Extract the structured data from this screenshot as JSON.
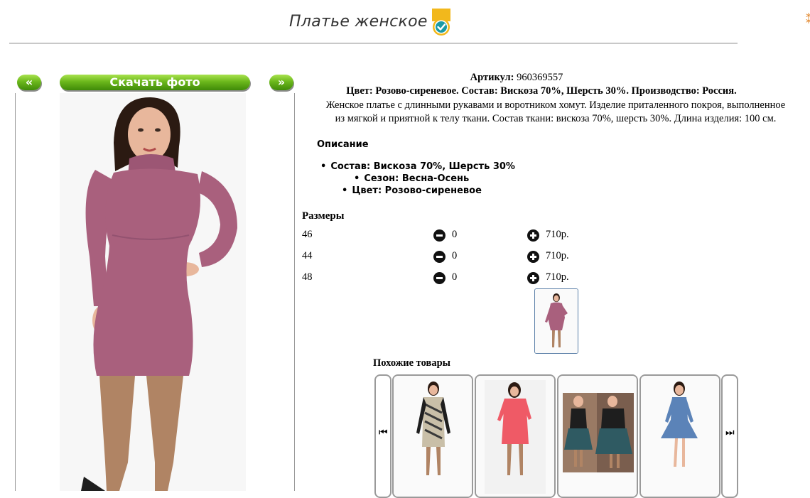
{
  "product": {
    "title": "Платье женское",
    "article_label": "Артикул:",
    "article_value": "960369557",
    "spec_line": "Цвет: Розово-сиреневое. Состав: Вискоза 70%, Шерсть 30%. Производство: Россия.",
    "description_line1": "Женское платье с длинными рукавами и воротником хомут. Изделие приталенного покроя, выполненное",
    "description_line2": "из мягкой и приятной к телу ткани. Состав ткани: вискоза 70%, шерсть 30%. Длина изделия: 100 см.",
    "verified_icon": "check-badge-icon"
  },
  "photo_nav": {
    "prev_label": "«",
    "download_label": "Скачать фото",
    "next_label": "»"
  },
  "description_block": {
    "title": "Описание",
    "items": [
      "Состав: Вискоза 70%, Шерсть 30%",
      "Сезон: Весна-Осень",
      "Цвет: Розово-сиреневое"
    ]
  },
  "sizes": {
    "title": "Размеры",
    "rows": [
      {
        "size": "46",
        "qty": "0",
        "price": "710р."
      },
      {
        "size": "44",
        "qty": "0",
        "price": "710р."
      },
      {
        "size": "48",
        "qty": "0",
        "price": "710р."
      }
    ]
  },
  "similar": {
    "title": "Похожие товары",
    "prev_icon": "skip-prev-icon",
    "next_icon": "skip-next-icon"
  },
  "colors": {
    "accent_green": "#6cb81c",
    "dress_mauve": "#a9607d",
    "badge_gold": "#f2b81c",
    "badge_teal": "#1a9aa5"
  }
}
